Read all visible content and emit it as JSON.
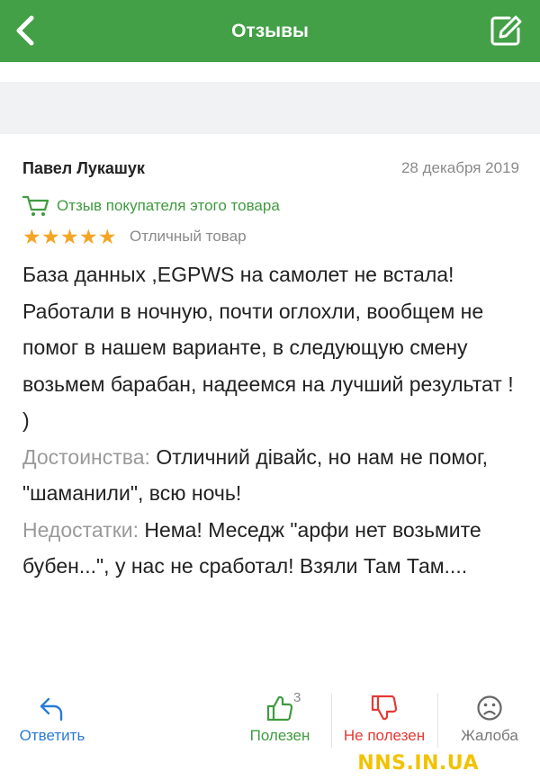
{
  "header": {
    "title": "Отзывы",
    "back_icon": "chevron-left-icon",
    "edit_icon": "edit-icon",
    "color": "#43a047"
  },
  "review": {
    "author": "Павел Лукашук",
    "date": "28 декабря 2019",
    "buyer_badge": "Отзыв покупателя этого товара",
    "rating": 5,
    "rating_max": 5,
    "rating_text": "Отличный товар",
    "body": "База данных ,EGPWS на самолет не встала! Работали в ночную, почти оглохли, вообщем не помог в нашем варианте, в следующую смену возьмем барабан, надеемся на лучший результат ! )",
    "pros_label": "Достоинства:",
    "pros": "Отличний дівайс, но нам не помог, \"шаманили\", всю ночь!",
    "cons_label": "Недостатки:",
    "cons": "Нема! Меседж \"арфи нет возьмите бубен...\", у нас не сработал! Взяли Там Там...."
  },
  "actions": {
    "reply": "Ответить",
    "useful": "Полезен",
    "useful_count": "3",
    "not_useful": "Не полезен",
    "complaint": "Жалоба"
  },
  "watermark": "NNS.IN.UA"
}
